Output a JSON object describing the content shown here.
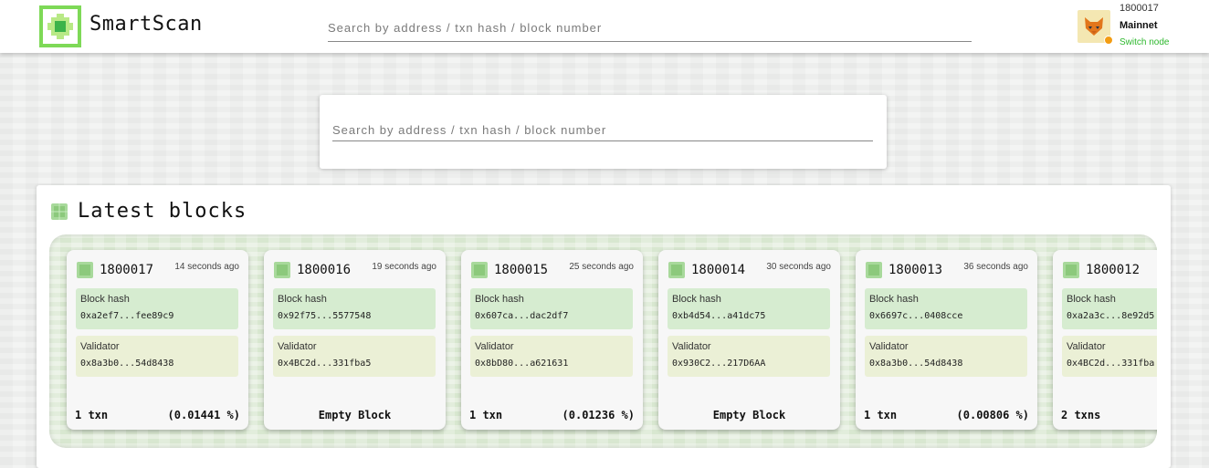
{
  "header": {
    "brand": "SmartScan",
    "search_placeholder": "Search by address / txn hash / block number",
    "block_number": "1800017",
    "network": "Mainnet",
    "switch_node": "Switch node"
  },
  "main_search": {
    "placeholder": "Search by address / txn hash / block number"
  },
  "latest_blocks": {
    "title": "Latest blocks",
    "hash_label": "Block hash",
    "validator_label": "Validator",
    "blocks": [
      {
        "number": "1800017",
        "age": "14 seconds ago",
        "hash": "0xa2ef7...fee89c9",
        "validator": "0x8a3b0...54d8438",
        "txns": "1 txn",
        "pct": "(0.01441 %)",
        "empty": ""
      },
      {
        "number": "1800016",
        "age": "19 seconds ago",
        "hash": "0x92f75...5577548",
        "validator": "0x4BC2d...331fba5",
        "txns": "",
        "pct": "",
        "empty": "Empty Block"
      },
      {
        "number": "1800015",
        "age": "25 seconds ago",
        "hash": "0x607ca...dac2df7",
        "validator": "0x8bD80...a621631",
        "txns": "1 txn",
        "pct": "(0.01236 %)",
        "empty": ""
      },
      {
        "number": "1800014",
        "age": "30 seconds ago",
        "hash": "0xb4d54...a41dc75",
        "validator": "0x930C2...217D6AA",
        "txns": "",
        "pct": "",
        "empty": "Empty Block"
      },
      {
        "number": "1800013",
        "age": "36 seconds ago",
        "hash": "0x6697c...0408cce",
        "validator": "0x8a3b0...54d8438",
        "txns": "1 txn",
        "pct": "(0.00806 %)",
        "empty": ""
      },
      {
        "number": "1800012",
        "age": "",
        "hash": "0xa2a3c...8e92d5",
        "validator": "0x4BC2d...331fba",
        "txns": "2 txns",
        "pct": "",
        "empty": ""
      }
    ]
  },
  "colors": {
    "accent": "#2eb82e",
    "logo_green": "#7ed957",
    "hash_bg": "#d6ecd0",
    "validator_bg": "#ebf0d6"
  },
  "icons": {
    "logo": "cube-scan-logo-icon",
    "block": "block-cube-icon",
    "avatar": "fox-avatar-icon"
  }
}
